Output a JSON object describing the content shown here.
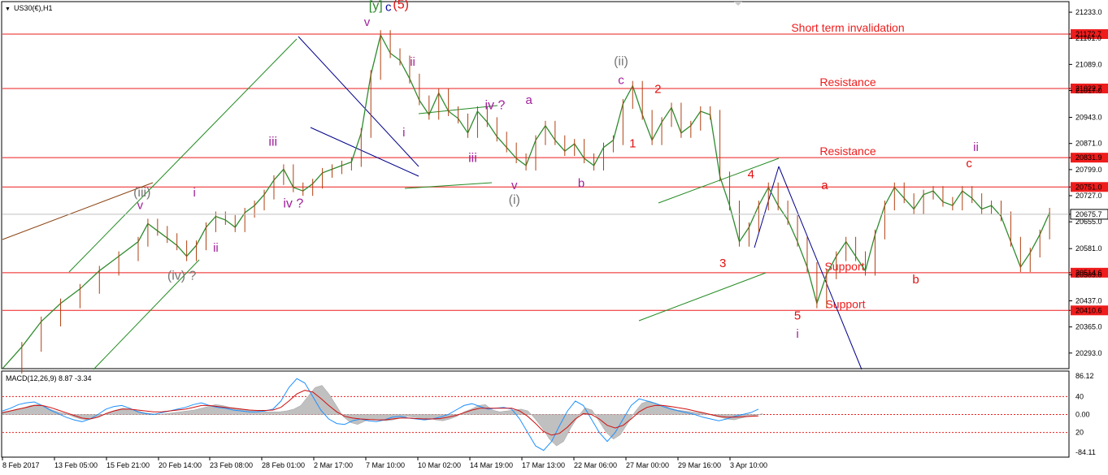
{
  "chart_data": {
    "type": "line",
    "title": "US30(€),H1",
    "symbol_caret": "▼",
    "price_axis": {
      "ylim": [
        20250,
        21260
      ],
      "ticks": [
        "21233.0",
        "21172.7",
        "21161.0",
        "21089.0",
        "21022.7",
        "21017.0",
        "20943.0",
        "20871.0",
        "20831.9",
        "20799.0",
        "20751.0",
        "20727.0",
        "20675.7",
        "20655.0",
        "20581.0",
        "20514.6",
        "20509.0",
        "20437.0",
        "20410.6",
        "20365.0",
        "20293.0"
      ]
    },
    "time_axis": {
      "ticks": [
        "8 Feb 2017",
        "13 Feb 05:00",
        "15 Feb 21:00",
        "20 Feb 14:00",
        "23 Feb 08:00",
        "28 Feb 01:00",
        "2 Mar 17:00",
        "7 Mar 10:00",
        "10 Mar 02:00",
        "14 Mar 19:00",
        "17 Mar 13:00",
        "22 Mar 06:00",
        "27 Mar 00:00",
        "29 Mar 16:00",
        "3 Apr 10:00"
      ]
    },
    "levels": [
      {
        "label": "Short term invalidation",
        "value": 21172.7,
        "value_label": "21172.7"
      },
      {
        "label": "Resistance",
        "value": 21022.7,
        "value_label": "21022.7"
      },
      {
        "label": "Resistance",
        "value": 20831.9,
        "value_label": "20831.9"
      },
      {
        "label": "",
        "value": 20751.0,
        "value_label": "20751.0"
      },
      {
        "label": "Support",
        "value": 20514.6,
        "value_label": "20514.6"
      },
      {
        "label": "Support",
        "value": 20410.6,
        "value_label": "20410.6"
      }
    ],
    "current_price": {
      "value": 20675.7,
      "label": "20675.7"
    },
    "price_series": {
      "name": "",
      "points": [
        [
          0,
          20250
        ],
        [
          2,
          20310
        ],
        [
          4,
          20380
        ],
        [
          6,
          20430
        ],
        [
          8,
          20470
        ],
        [
          10,
          20520
        ],
        [
          12,
          20560
        ],
        [
          14,
          20600
        ],
        [
          15,
          20650
        ],
        [
          16,
          20630
        ],
        [
          17,
          20610
        ],
        [
          18,
          20590
        ],
        [
          19,
          20560
        ],
        [
          20,
          20590
        ],
        [
          21,
          20640
        ],
        [
          22,
          20670
        ],
        [
          23,
          20660
        ],
        [
          24,
          20640
        ],
        [
          25,
          20680
        ],
        [
          26,
          20700
        ],
        [
          27,
          20730
        ],
        [
          28,
          20770
        ],
        [
          29,
          20800
        ],
        [
          30,
          20750
        ],
        [
          31,
          20740
        ],
        [
          32,
          20760
        ],
        [
          33,
          20790
        ],
        [
          34,
          20800
        ],
        [
          35,
          20810
        ],
        [
          36,
          20820
        ],
        [
          37,
          20900
        ],
        [
          38,
          21060
        ],
        [
          39,
          21170
        ],
        [
          40,
          21120
        ],
        [
          41,
          21100
        ],
        [
          42,
          21050
        ],
        [
          43,
          20990
        ],
        [
          44,
          20950
        ],
        [
          45,
          21010
        ],
        [
          46,
          20960
        ],
        [
          47,
          20940
        ],
        [
          48,
          20900
        ],
        [
          49,
          20960
        ],
        [
          50,
          20930
        ],
        [
          51,
          20890
        ],
        [
          52,
          20860
        ],
        [
          53,
          20830
        ],
        [
          54,
          20810
        ],
        [
          55,
          20880
        ],
        [
          56,
          20920
        ],
        [
          57,
          20880
        ],
        [
          58,
          20850
        ],
        [
          59,
          20870
        ],
        [
          60,
          20830
        ],
        [
          61,
          20810
        ],
        [
          62,
          20860
        ],
        [
          63,
          20880
        ],
        [
          64,
          20980
        ],
        [
          65,
          21030
        ],
        [
          66,
          20950
        ],
        [
          67,
          20880
        ],
        [
          68,
          20930
        ],
        [
          69,
          20970
        ],
        [
          70,
          20900
        ],
        [
          71,
          20920
        ],
        [
          72,
          20960
        ],
        [
          73,
          20950
        ],
        [
          74,
          20780
        ],
        [
          75,
          20700
        ],
        [
          76,
          20600
        ],
        [
          77,
          20640
        ],
        [
          78,
          20700
        ],
        [
          79,
          20750
        ],
        [
          80,
          20700
        ],
        [
          81,
          20660
        ],
        [
          82,
          20600
        ],
        [
          83,
          20530
        ],
        [
          84,
          20430
        ],
        [
          85,
          20510
        ],
        [
          86,
          20560
        ],
        [
          87,
          20600
        ],
        [
          88,
          20560
        ],
        [
          89,
          20520
        ],
        [
          90,
          20620
        ],
        [
          91,
          20700
        ],
        [
          92,
          20750
        ],
        [
          93,
          20720
        ],
        [
          94,
          20690
        ],
        [
          95,
          20730
        ],
        [
          96,
          20740
        ],
        [
          97,
          20710
        ],
        [
          98,
          20700
        ],
        [
          99,
          20740
        ],
        [
          100,
          20720
        ],
        [
          101,
          20690
        ],
        [
          102,
          20700
        ],
        [
          103,
          20670
        ],
        [
          104,
          20600
        ],
        [
          105,
          20530
        ],
        [
          106,
          20570
        ],
        [
          107,
          20620
        ],
        [
          108,
          20680
        ]
      ]
    },
    "wave_labels": [
      {
        "text": "[y]",
        "color": "#2e8b2e",
        "x": 38.5,
        "y": 21240
      },
      {
        "text": "c",
        "color": "#0a0aaa",
        "x": 39.8,
        "y": 21237
      },
      {
        "text": "(5)",
        "color": "#e01010",
        "x": 41.1,
        "y": 21243
      },
      {
        "text": "v",
        "color": "#a0219b",
        "x": 37.6,
        "y": 21195
      },
      {
        "text": "ii",
        "color": "#a0219b",
        "x": 42.3,
        "y": 21085
      },
      {
        "text": "i",
        "color": "#a0219b",
        "x": 41.4,
        "y": 20890
      },
      {
        "text": "iii",
        "color": "#a0219b",
        "x": 48.5,
        "y": 20820
      },
      {
        "text": "iv ?",
        "color": "#a0219b",
        "x": 50.8,
        "y": 20965
      },
      {
        "text": "a",
        "color": "#a0219b",
        "x": 54.3,
        "y": 20980
      },
      {
        "text": "b",
        "color": "#a0219b",
        "x": 59.7,
        "y": 20750
      },
      {
        "text": "c",
        "color": "#a0219b",
        "x": 63.8,
        "y": 21035
      },
      {
        "text": "(ii)",
        "color": "#777777",
        "x": 63.8,
        "y": 21087
      },
      {
        "text": "v",
        "color": "#a0219b",
        "x": 52.8,
        "y": 20745
      },
      {
        "text": "(i)",
        "color": "#777777",
        "x": 52.8,
        "y": 20705
      },
      {
        "text": "(iii)",
        "color": "#777777",
        "x": 14.4,
        "y": 20725
      },
      {
        "text": "v",
        "color": "#a0219b",
        "x": 14.2,
        "y": 20690
      },
      {
        "text": "i",
        "color": "#a0219b",
        "x": 19.8,
        "y": 20725
      },
      {
        "text": "ii",
        "color": "#a0219b",
        "x": 22.0,
        "y": 20572
      },
      {
        "text": "iii",
        "color": "#a0219b",
        "x": 27.9,
        "y": 20865
      },
      {
        "text": "iv ?",
        "color": "#a0219b",
        "x": 30.0,
        "y": 20695
      },
      {
        "text": "(iv) ?",
        "color": "#777777",
        "x": 18.5,
        "y": 20495
      },
      {
        "text": "1",
        "color": "#e01010",
        "x": 65.0,
        "y": 20860
      },
      {
        "text": "2",
        "color": "#e01010",
        "x": 67.6,
        "y": 21010
      },
      {
        "text": "3",
        "color": "#e01010",
        "x": 74.3,
        "y": 20530
      },
      {
        "text": "4",
        "color": "#e01010",
        "x": 77.2,
        "y": 20775
      },
      {
        "text": "5",
        "color": "#e01010",
        "x": 82.0,
        "y": 20385
      },
      {
        "text": "i",
        "color": "#a0219b",
        "x": 82.0,
        "y": 20335
      },
      {
        "text": "a",
        "color": "#e01010",
        "x": 84.8,
        "y": 20745
      },
      {
        "text": "b",
        "color": "#e01010",
        "x": 94.2,
        "y": 20485
      },
      {
        "text": "c",
        "color": "#e01010",
        "x": 99.7,
        "y": 20805
      },
      {
        "text": "ii",
        "color": "#a0219b",
        "x": 100.4,
        "y": 20850
      }
    ],
    "macd": {
      "label": "MACD(12,26,9) 8.87 -3.34",
      "ylim": [
        -95,
        95
      ],
      "ticks": [
        "86.12",
        "40",
        "0.00",
        "20",
        "-84.11"
      ],
      "signal_line": "-3.34",
      "histogram": [
        5,
        8,
        12,
        15,
        20,
        22,
        18,
        10,
        5,
        2,
        -5,
        -10,
        -12,
        -8,
        -2,
        5,
        10,
        14,
        12,
        8,
        4,
        2,
        0,
        2,
        4,
        6,
        8,
        10,
        14,
        18,
        22,
        20,
        16,
        14,
        12,
        10,
        8,
        6,
        6,
        6,
        8,
        12,
        20,
        40,
        60,
        65,
        45,
        20,
        -5,
        -18,
        -22,
        -15,
        -10,
        -12,
        -14,
        -12,
        -8,
        -4,
        -6,
        -10,
        -8,
        -12,
        -14,
        -10,
        -4,
        6,
        12,
        20,
        22,
        10,
        6,
        8,
        10,
        12,
        8,
        -10,
        -30,
        -55,
        -70,
        -60,
        -30,
        -5,
        15,
        10,
        -15,
        -40,
        -55,
        -45,
        -20,
        5,
        25,
        30,
        25,
        20,
        15,
        10,
        8,
        6,
        4,
        2,
        -2,
        -6,
        -10,
        -12,
        -8,
        -4,
        -2,
        2
      ],
      "macd_line": [
        8,
        14,
        22,
        26,
        28,
        20,
        10,
        2,
        -6,
        -12,
        -16,
        -10,
        0,
        12,
        18,
        20,
        14,
        6,
        2,
        0,
        4,
        8,
        12,
        16,
        22,
        26,
        20,
        16,
        14,
        10,
        8,
        6,
        6,
        8,
        12,
        30,
        60,
        80,
        70,
        40,
        10,
        -10,
        -20,
        -22,
        -14,
        -10,
        -14,
        -16,
        -12,
        -6,
        -4,
        -8,
        -10,
        -12,
        -10,
        -6,
        0,
        10,
        20,
        24,
        18,
        12,
        14,
        16,
        12,
        -10,
        -40,
        -70,
        -80,
        -60,
        -25,
        8,
        30,
        20,
        -10,
        -40,
        -60,
        -40,
        -10,
        20,
        35,
        30,
        25,
        18,
        12,
        8,
        4,
        0,
        -6,
        -10,
        -14,
        -10,
        -4,
        0,
        4,
        12
      ],
      "signal_line_values": [
        4,
        8,
        12,
        16,
        20,
        20,
        16,
        10,
        4,
        -2,
        -8,
        -10,
        -6,
        2,
        8,
        12,
        12,
        10,
        8,
        6,
        6,
        8,
        10,
        12,
        16,
        20,
        20,
        18,
        16,
        14,
        12,
        10,
        9,
        9,
        10,
        16,
        30,
        46,
        54,
        50,
        36,
        20,
        6,
        -4,
        -8,
        -10,
        -11,
        -12,
        -12,
        -10,
        -8,
        -8,
        -9,
        -10,
        -10,
        -9,
        -6,
        -2,
        4,
        10,
        14,
        14,
        14,
        14,
        14,
        8,
        -4,
        -20,
        -38,
        -46,
        -42,
        -28,
        -10,
        2,
        0,
        -10,
        -24,
        -30,
        -24,
        -10,
        6,
        16,
        20,
        20,
        18,
        15,
        12,
        8,
        4,
        0,
        -4,
        -6,
        -6,
        -5,
        -4,
        -3
      ]
    }
  }
}
